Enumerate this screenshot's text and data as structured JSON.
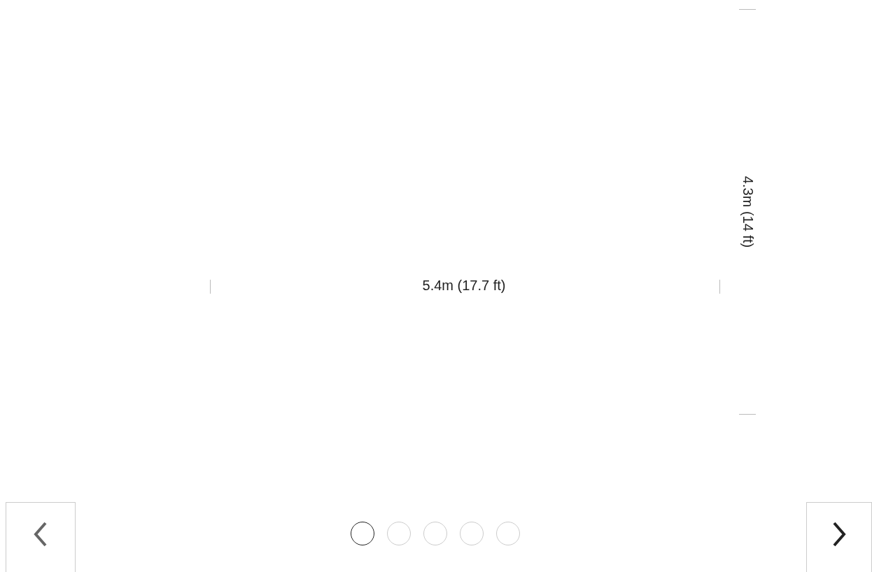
{
  "dimensions": {
    "width_label": "5.4m (17.7 ft)",
    "height_label": "4.3m (14 ft)"
  },
  "prev_button": {
    "disabled": true
  },
  "next_button": {
    "disabled": false
  },
  "pager": [
    {
      "selected": true
    },
    {
      "selected": false
    },
    {
      "selected": false
    },
    {
      "selected": false
    },
    {
      "selected": false
    }
  ]
}
